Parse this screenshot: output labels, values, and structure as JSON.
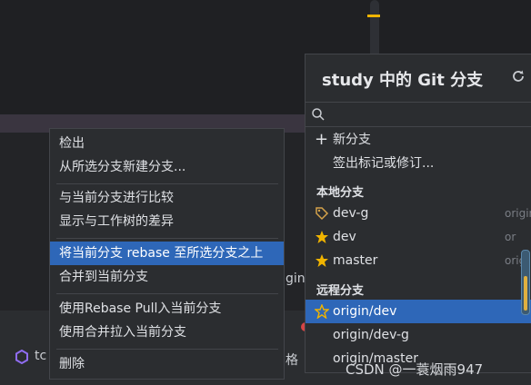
{
  "background": {
    "bottom_left_label": "tc",
    "bottom_mid_label": "格",
    "partial_text": "gin/"
  },
  "context_menu": {
    "items": [
      {
        "label": "检出"
      },
      {
        "label": "从所选分支新建分支..."
      },
      {
        "label": "与当前分支进行比较"
      },
      {
        "label": "显示与工作树的差异"
      },
      {
        "label": "将当前分支 rebase 至所选分支之上"
      },
      {
        "label": "合并到当前分支"
      },
      {
        "label": "使用Rebase Pull入当前分支"
      },
      {
        "label": "使用合并拉入当前分支"
      },
      {
        "label": "删除"
      }
    ],
    "active_label": "将当前分支 rebase 至所选分支之上"
  },
  "git_popup": {
    "title": "study 中的 Git 分支",
    "search": {
      "value": "",
      "placeholder": ""
    },
    "actions": [
      {
        "label": "新分支"
      },
      {
        "label": "签出标记或修订..."
      }
    ],
    "local_section": "本地分支",
    "local_branches": [
      {
        "name": "dev-g",
        "icon": "tag-icon",
        "track": "origin"
      },
      {
        "name": "dev",
        "icon": "star-icon",
        "track": "or"
      },
      {
        "name": "master",
        "icon": "star-icon",
        "track": "origi"
      }
    ],
    "remote_section": "远程分支",
    "remote_branches": [
      {
        "name": "origin/dev",
        "icon": "star-outline-icon"
      },
      {
        "name": "origin/dev-g",
        "icon": ""
      },
      {
        "name": "origin/master",
        "icon": ""
      }
    ]
  },
  "watermark": "CSDN @一蓑烟雨947",
  "colors": {
    "selection": "#2e67b8",
    "star": "#f0b400",
    "tag": "#d4a24a",
    "menu_bg": "#2b2d30"
  }
}
